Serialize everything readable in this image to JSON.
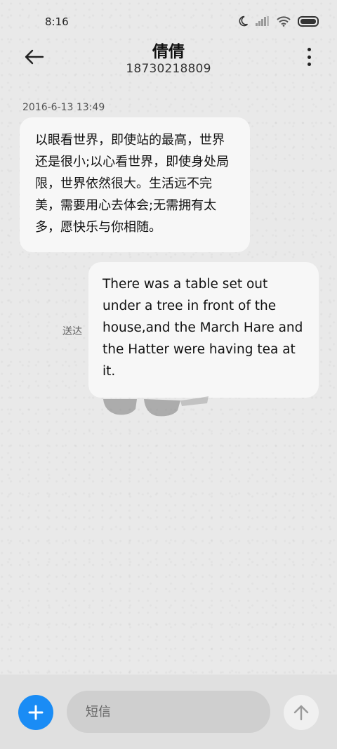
{
  "status_bar": {
    "time": "8:16"
  },
  "header": {
    "contact_name": "倩倩",
    "phone_number": "18730218809"
  },
  "conversation": {
    "timestamp": "2016-6-13 13:49",
    "messages": [
      {
        "direction": "incoming",
        "text": "以眼看世界，即使站的最高，世界还是很小;以心看世界，即使身处局限，世界依然很大。生活远不完美，需要用心去体会;无需拥有太多，愿快乐与你相随。"
      },
      {
        "direction": "outgoing",
        "text": "There was a table set out under a tree in front of the house,and the March Hare and the Hatter were having tea at it.",
        "status": "送达"
      }
    ]
  },
  "composer": {
    "placeholder": "短信"
  },
  "colors": {
    "accent": "#1a8cf5",
    "background": "#e9e9e9",
    "bubble": "#f7f7f7"
  }
}
